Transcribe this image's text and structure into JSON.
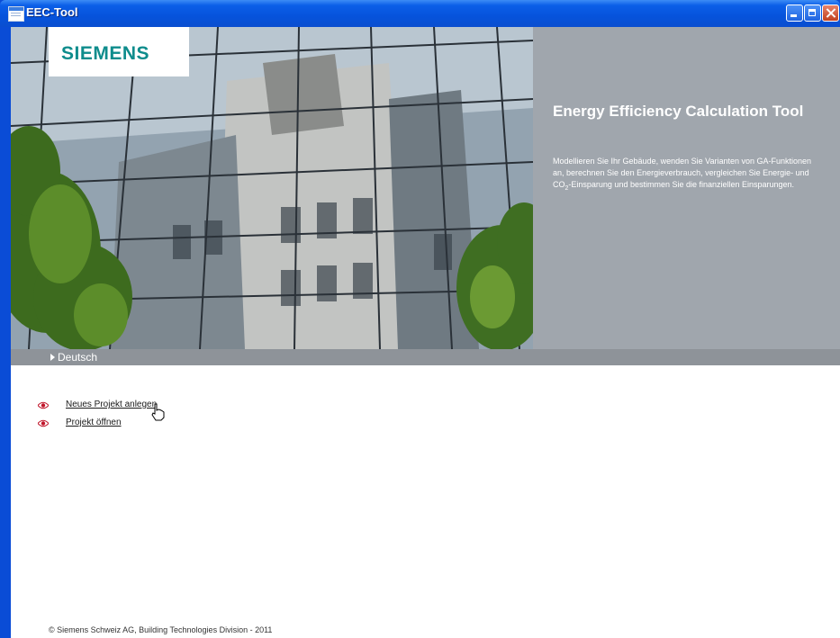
{
  "window": {
    "title": "EEC-Tool",
    "controls": {
      "minimize": "minimize-icon",
      "maximize": "maximize-icon",
      "close": "close-icon"
    }
  },
  "hero": {
    "logo": "SIEMENS"
  },
  "info": {
    "title": "Energy Efficiency Calculation Tool",
    "desc_before": "Modellieren Sie Ihr Gebäude, wenden Sie Varianten von GA-Funktionen an, berechnen Sie den Energieverbrauch, vergleichen Sie Energie- und CO",
    "desc_sub": "2",
    "desc_after": "-Einsparung und bestimmen Sie die finanziellen Einsparungen."
  },
  "language": {
    "label": "Deutsch"
  },
  "actions": [
    {
      "label": "Neues Projekt anlegen",
      "icon": "eye-icon"
    },
    {
      "label": "Projekt öffnen",
      "icon": "eye-icon"
    }
  ],
  "footer": {
    "text": "© Siemens Schweiz AG, Building Technologies Division - 2011"
  },
  "colors": {
    "title_bar": "#0653dc",
    "brand": "#0e8c8c",
    "panel": "#a0a6ad",
    "lang_bar": "#8e9399",
    "link_icon": "#c0152a"
  }
}
